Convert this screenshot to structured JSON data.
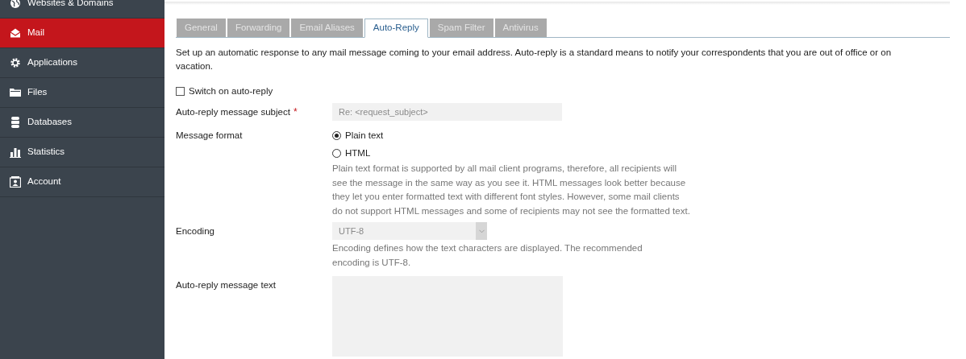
{
  "sidebar": {
    "items": [
      {
        "label": "Websites & Domains",
        "selected": false
      },
      {
        "label": "Mail",
        "selected": true
      },
      {
        "label": "Applications",
        "selected": false
      },
      {
        "label": "Files",
        "selected": false
      },
      {
        "label": "Databases",
        "selected": false
      },
      {
        "label": "Statistics",
        "selected": false
      },
      {
        "label": "Account",
        "selected": false
      }
    ]
  },
  "tabs": [
    {
      "label": "General",
      "selected": false
    },
    {
      "label": "Forwarding",
      "selected": false
    },
    {
      "label": "Email Aliases",
      "selected": false
    },
    {
      "label": "Auto-Reply",
      "selected": true
    },
    {
      "label": "Spam Filter",
      "selected": false
    },
    {
      "label": "Antivirus",
      "selected": false
    }
  ],
  "description": "Set up an automatic response to any mail message coming to your email address. Auto-reply is a standard means to notify your correspondents that you are out of office or on vacation.",
  "switch": {
    "label": "Switch on auto-reply",
    "checked": false
  },
  "subject": {
    "label": "Auto-reply message subject",
    "required_mark": "*",
    "placeholder": "Re: <request_subject>",
    "disabled": true
  },
  "format": {
    "label": "Message format",
    "options": [
      {
        "label": "Plain text",
        "selected": true
      },
      {
        "label": "HTML",
        "selected": false
      }
    ],
    "hint": "Plain text format is supported by all mail client programs, therefore, all recipients will see the message in the same way as you see it. HTML messages look better because they let you enter formatted text with different font styles. However, some mail clients do not support HTML messages and some of recipients may not see the formatted text."
  },
  "encoding": {
    "label": "Encoding",
    "value": "UTF-8",
    "disabled": true,
    "hint": "Encoding defines how the text characters are displayed. The recommended encoding is UTF-8."
  },
  "message_text": {
    "label": "Auto-reply message text",
    "disabled": true
  }
}
